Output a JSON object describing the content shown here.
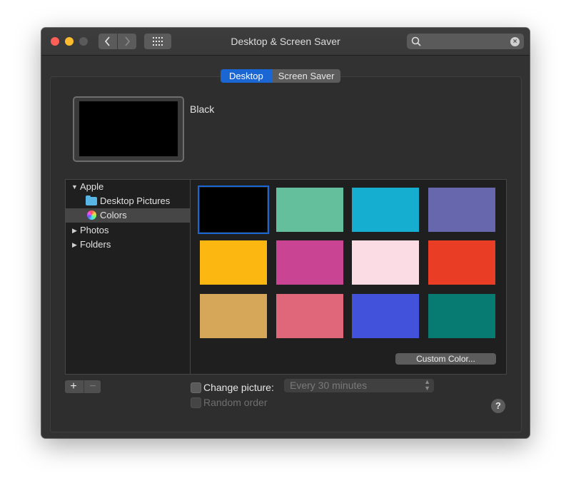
{
  "window": {
    "title": "Desktop & Screen Saver"
  },
  "toolbar": {
    "back_icon": "chevron-left-icon",
    "forward_icon": "chevron-right-icon",
    "grid_icon": "grid-icon",
    "search_placeholder": ""
  },
  "tabs": [
    {
      "label": "Desktop",
      "active": true
    },
    {
      "label": "Screen Saver",
      "active": false
    }
  ],
  "preview": {
    "name": "Black",
    "color": "#000000"
  },
  "sidebar": {
    "items": [
      {
        "label": "Apple",
        "expanded": true
      },
      {
        "label": "Desktop Pictures",
        "icon": "folder-icon"
      },
      {
        "label": "Colors",
        "icon": "color-wheel-icon",
        "selected": true
      },
      {
        "label": "Photos",
        "expanded": false
      },
      {
        "label": "Folders",
        "expanded": false
      }
    ]
  },
  "swatches": [
    {
      "color": "#000000",
      "selected": true
    },
    {
      "color": "#64bf9c"
    },
    {
      "color": "#16aed0"
    },
    {
      "color": "#6767ae"
    },
    {
      "color": "#fdb711"
    },
    {
      "color": "#c94594"
    },
    {
      "color": "#fbdce4"
    },
    {
      "color": "#e93d26"
    },
    {
      "color": "#d6a758"
    },
    {
      "color": "#e0677a"
    },
    {
      "color": "#4352db"
    },
    {
      "color": "#077a71"
    }
  ],
  "custom_color_label": "Custom Color...",
  "buttons": {
    "add_label": "+",
    "remove_label": "−"
  },
  "change_picture": {
    "label": "Change picture:",
    "checked": false,
    "interval": "Every 30 minutes"
  },
  "random_order": {
    "label": "Random order",
    "enabled": false
  },
  "help_label": "?"
}
